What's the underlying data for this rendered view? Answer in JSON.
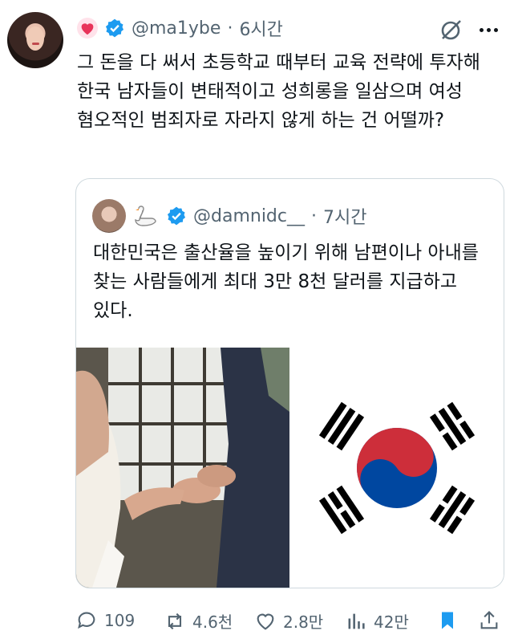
{
  "tweet": {
    "handle": "@ma1ybe",
    "separator": "·",
    "time": "6시간",
    "text": "그 돈을 다 써서 초등학교 때부터 교육 전략에 투자해 한국 남자들이 변태적이고 성희롱을 일삼으며 여성 혐오적인 범죄자로 자라지 않게 하는 건 어떨까?"
  },
  "quoted": {
    "handle": "@damnidc__",
    "separator": "·",
    "time": "7시간",
    "text": "대한민국은 출산율을 높이기 위해 남편이나 아내를 찾는 사람들에게 최대 3만 8천 달러를 지급하고 있다."
  },
  "actions": {
    "replies": "109",
    "reposts": "4.6천",
    "likes": "2.8만",
    "views": "42만"
  },
  "colors": {
    "verified": "#1d9bf0",
    "muted": "#536471",
    "bookmark": "#1d9bf0"
  },
  "icons": [
    "heart-icon",
    "verified-icon",
    "grok-icon",
    "more-icon",
    "swan-icon",
    "reply-icon",
    "repost-icon",
    "like-icon",
    "views-icon",
    "bookmark-icon",
    "share-icon"
  ]
}
